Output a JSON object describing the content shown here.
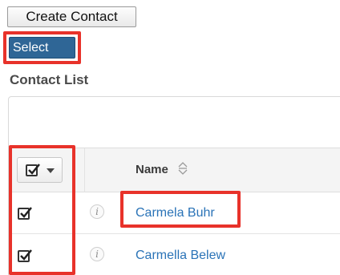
{
  "actions": {
    "create_label": "Create Contact",
    "select_label": "Select"
  },
  "list": {
    "title": "Contact List",
    "columns": {
      "name": "Name"
    },
    "rows": [
      {
        "name": "Carmela Buhr",
        "info_icon": "i",
        "checked": true
      },
      {
        "name": "Carmella Belew",
        "info_icon": "i",
        "checked": true
      }
    ]
  },
  "icons": {
    "mass_select": "checkbox-icon",
    "dropdown": "chevron-down-icon",
    "sort": "sort-icon",
    "info": "info-icon"
  },
  "colors": {
    "highlight": "#e8322a",
    "select_button": "#2f6696",
    "link": "#2a73b7"
  }
}
